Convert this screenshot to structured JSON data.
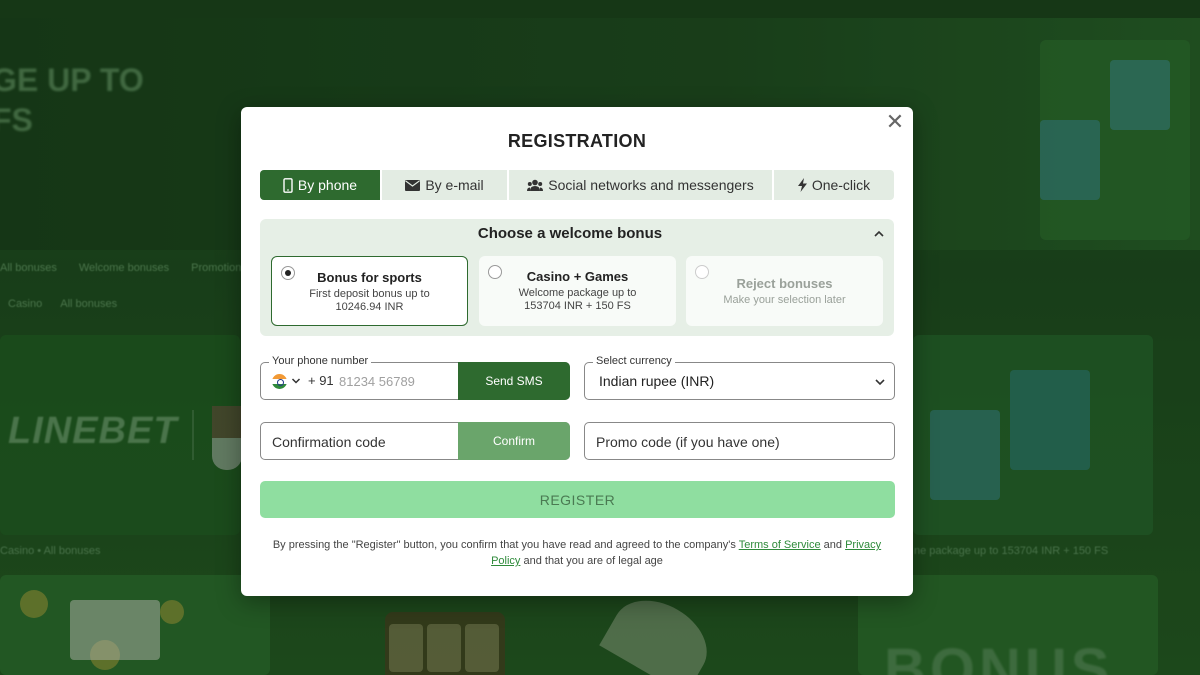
{
  "background": {
    "hero_line1": "GE UP TO",
    "hero_line2": "FS",
    "tabs_row1": [
      "All bonuses",
      "Welcome bonuses",
      "Promotions"
    ],
    "tabs_row2": [
      "Casino",
      "All bonuses"
    ],
    "logo": "LINEBET",
    "caption_left": "Casino • All bonuses",
    "caption_right": "ne package up to 153704 INR + 150 FS",
    "bonus_word": "BONUS"
  },
  "modal": {
    "close_glyph": "✕",
    "title": "REGISTRATION",
    "tabs": [
      {
        "label": "By phone",
        "icon": "phone-icon",
        "active": true
      },
      {
        "label": "By e-mail",
        "icon": "envelope-icon",
        "active": false
      },
      {
        "label": "Social networks and messengers",
        "icon": "users-icon",
        "active": false
      },
      {
        "label": "One-click",
        "icon": "lightning-icon",
        "active": false
      }
    ],
    "bonus": {
      "title": "Choose a welcome bonus",
      "options": [
        {
          "title": "Bonus for sports",
          "subtitle": "First deposit bonus up to 10246.94 INR",
          "selected": true
        },
        {
          "title": "Casino + Games",
          "subtitle": "Welcome package up to 153704 INR + 150 FS",
          "selected": false
        },
        {
          "title": "Reject bonuses",
          "subtitle": "Make your selection later",
          "selected": false
        }
      ]
    },
    "phone": {
      "legend": "Your phone number",
      "country_flag": "india-flag-icon",
      "prefix": "+ 91",
      "placeholder": "81234 56789",
      "send_label": "Send SMS"
    },
    "currency": {
      "legend": "Select currency",
      "value": "Indian rupee (INR)"
    },
    "confirmation": {
      "placeholder": "Confirmation code",
      "confirm_label": "Confirm"
    },
    "promo": {
      "placeholder": "Promo code (if you have one)"
    },
    "register_label": "REGISTER",
    "legal": {
      "before": "By pressing the \"Register\" button, you confirm that you have read and agreed to the company's ",
      "terms": "Terms of Service",
      "and": " and ",
      "privacy": "Privacy Policy",
      "after": " and that you are of legal age"
    }
  },
  "colors": {
    "accent": "#2e6a2f",
    "register_bg": "#8fdea0",
    "link": "#2e8a3a"
  }
}
